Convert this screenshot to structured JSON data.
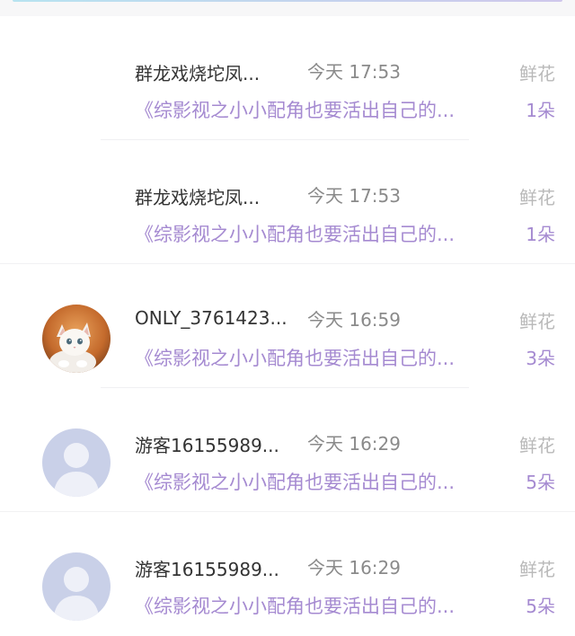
{
  "rows": [
    {
      "user_name": "群龙戏烧坨凤...",
      "time": "今天 17:53",
      "gift_type": "鲜花",
      "book_title": "《综影视之小小配角也要活出自己的...",
      "gift_count": "1朵",
      "avatar": "none"
    },
    {
      "user_name": "群龙戏烧坨凤...",
      "time": "今天 17:53",
      "gift_type": "鲜花",
      "book_title": "《综影视之小小配角也要活出自己的...",
      "gift_count": "1朵",
      "avatar": "none"
    },
    {
      "user_name": "ONLY_3761423...",
      "time": "今天 16:59",
      "gift_type": "鲜花",
      "book_title": "《综影视之小小配角也要活出自己的...",
      "gift_count": "3朵",
      "avatar": "white-kitten-photo"
    },
    {
      "user_name": "游客16155989...",
      "time": "今天 16:29",
      "gift_type": "鲜花",
      "book_title": "《综影视之小小配角也要活出自己的...",
      "gift_count": "5朵",
      "avatar": "default-user-silhouette"
    },
    {
      "user_name": "游客16155989...",
      "time": "今天 16:29",
      "gift_type": "鲜花",
      "book_title": "《综影视之小小配角也要活出自己的...",
      "gift_count": "5朵",
      "avatar": "default-user-silhouette"
    }
  ],
  "colors": {
    "accent_purple": "#a58ad1",
    "name_text": "#333333",
    "muted_text": "#8a8a8a",
    "gift_label": "#b9b9b9",
    "default_avatar_bg": "#c9d0e8"
  }
}
